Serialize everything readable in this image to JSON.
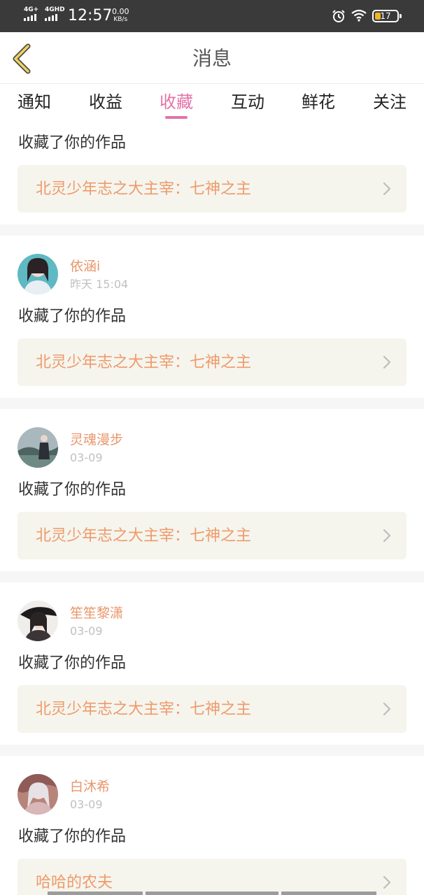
{
  "status_bar": {
    "signal1": "4G+",
    "signal2": "4GHD",
    "time": "12:57",
    "speed_value": "0.00",
    "speed_unit": "KB/s",
    "battery": "17",
    "battery_level": 0.17,
    "icons": [
      "alarm-icon",
      "wifi-icon",
      "battery-icon"
    ]
  },
  "header": {
    "title": "消息",
    "back_icon": "chevron-left-icon"
  },
  "tabs": [
    {
      "label": "通知"
    },
    {
      "label": "收益"
    },
    {
      "label": "收藏",
      "active": true
    },
    {
      "label": "互动"
    },
    {
      "label": "鲜花"
    },
    {
      "label": "关注"
    }
  ],
  "feed": {
    "partial_item": {
      "action": "收藏了你的作品",
      "work": "北灵少年志之大主宰：七神之主"
    },
    "items": [
      {
        "user": "依涵i",
        "time": "昨天 15:04",
        "action": "收藏了你的作品",
        "work": "北灵少年志之大主宰：七神之主"
      },
      {
        "user": "灵魂漫步",
        "time": "03-09",
        "action": "收藏了你的作品",
        "work": "北灵少年志之大主宰：七神之主"
      },
      {
        "user": "笙笙黎潇",
        "time": "03-09",
        "action": "收藏了你的作品",
        "work": "北灵少年志之大主宰：七神之主"
      },
      {
        "user": "白沐希",
        "time": "03-09",
        "action": "收藏了你的作品",
        "work": "哈哈的农夫"
      }
    ]
  },
  "colors": {
    "accent_pink": "#e473a9",
    "username_orange": "#e8966a",
    "work_title_orange": "#ef9a6a",
    "card_bg": "#f5f5ee",
    "status_bar_bg": "#3a3a3a",
    "battery_fill": "#f0b429"
  }
}
